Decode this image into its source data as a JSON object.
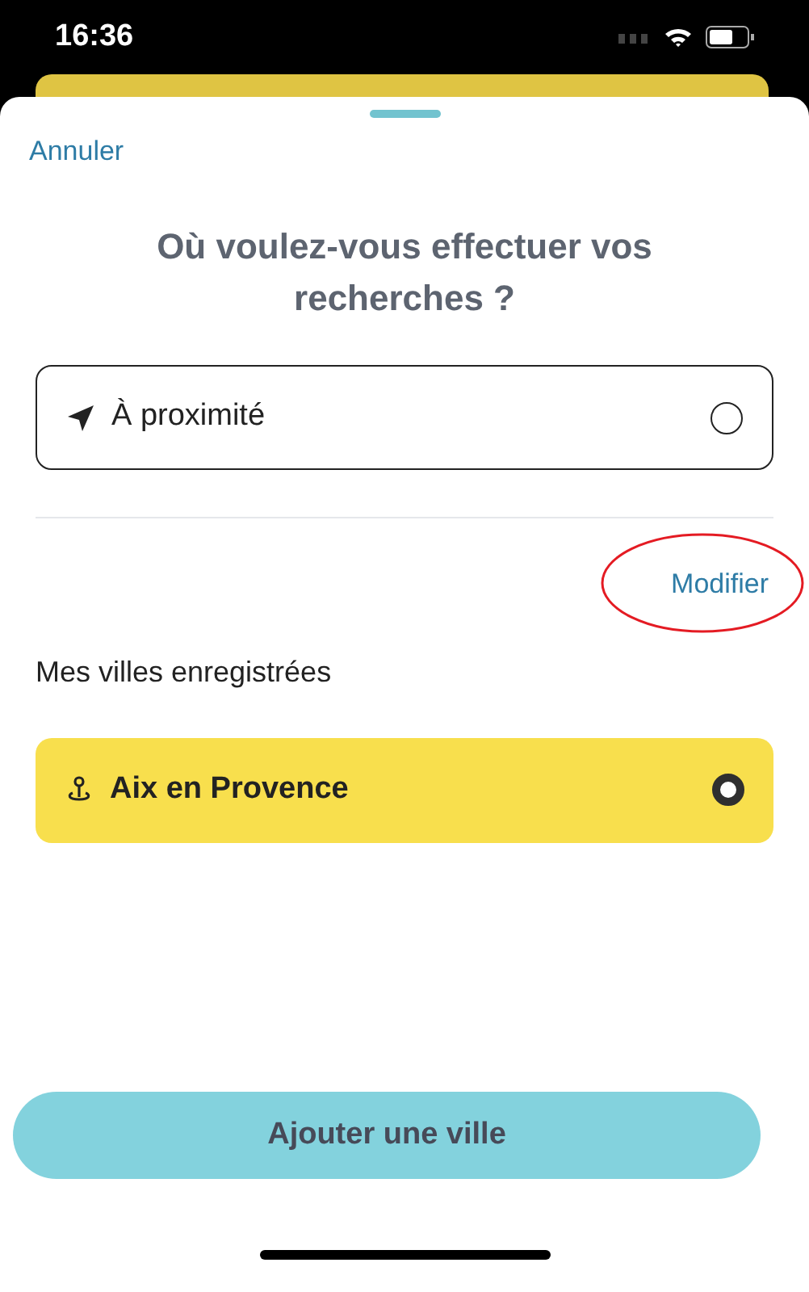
{
  "status_bar": {
    "time": "16:36"
  },
  "sheet": {
    "cancel": "Annuler",
    "title": "Où voulez-vous effectuer vos recherches ?"
  },
  "nearby": {
    "label": "À proximité",
    "selected": false
  },
  "edit_link": "Modifier",
  "saved_cities": {
    "heading": "Mes villes enregistrées",
    "items": [
      {
        "name": "Aix en Provence",
        "selected": true
      }
    ]
  },
  "add_button": "Ajouter une ville"
}
